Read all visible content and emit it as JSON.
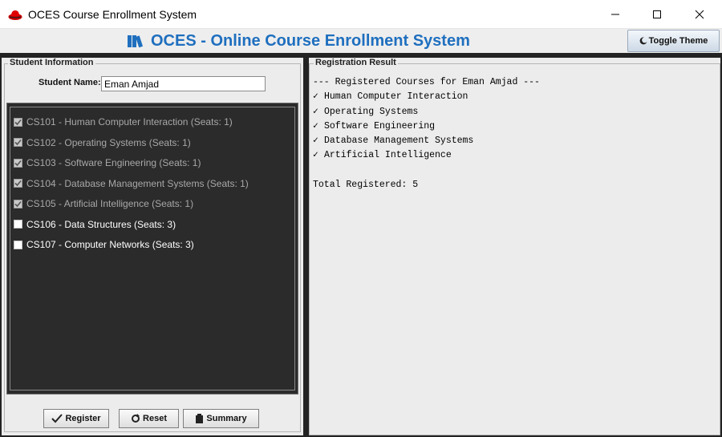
{
  "window": {
    "title": "OCES Course Enrollment System"
  },
  "header": {
    "title": "OCES - Online Course Enrollment System",
    "toggle_label": "Toggle Theme"
  },
  "student_panel": {
    "group_title": "Student Information",
    "name_label": "Student Name:",
    "name_value": "Eman Amjad",
    "courses": [
      {
        "label": "CS101 - Human Computer Interaction (Seats: 1)",
        "checked": true,
        "enabled": false
      },
      {
        "label": "CS102 - Operating Systems (Seats: 1)",
        "checked": true,
        "enabled": false
      },
      {
        "label": "CS103 - Software Engineering (Seats: 1)",
        "checked": true,
        "enabled": false
      },
      {
        "label": "CS104 - Database Management Systems (Seats: 1)",
        "checked": true,
        "enabled": false
      },
      {
        "label": "CS105 - Artificial Intelligence (Seats: 1)",
        "checked": true,
        "enabled": false
      },
      {
        "label": "CS106 - Data Structures (Seats: 3)",
        "checked": false,
        "enabled": true
      },
      {
        "label": "CS107 - Computer Networks (Seats: 3)",
        "checked": false,
        "enabled": true
      }
    ],
    "buttons": {
      "register": "Register",
      "reset": "Reset",
      "summary": "Summary"
    }
  },
  "result_panel": {
    "title": "Registration Result",
    "heading": "--- Registered Courses for Eman Amjad ---",
    "check_mark": "✓",
    "registered": [
      "Human Computer Interaction",
      "Operating Systems",
      "Software Engineering",
      "Database Management Systems",
      "Artificial Intelligence"
    ],
    "total": "Total Registered: 5"
  },
  "colors": {
    "header_title": "#1f6fbf",
    "dark_bg": "#232323",
    "panel_bg": "#ececec"
  }
}
